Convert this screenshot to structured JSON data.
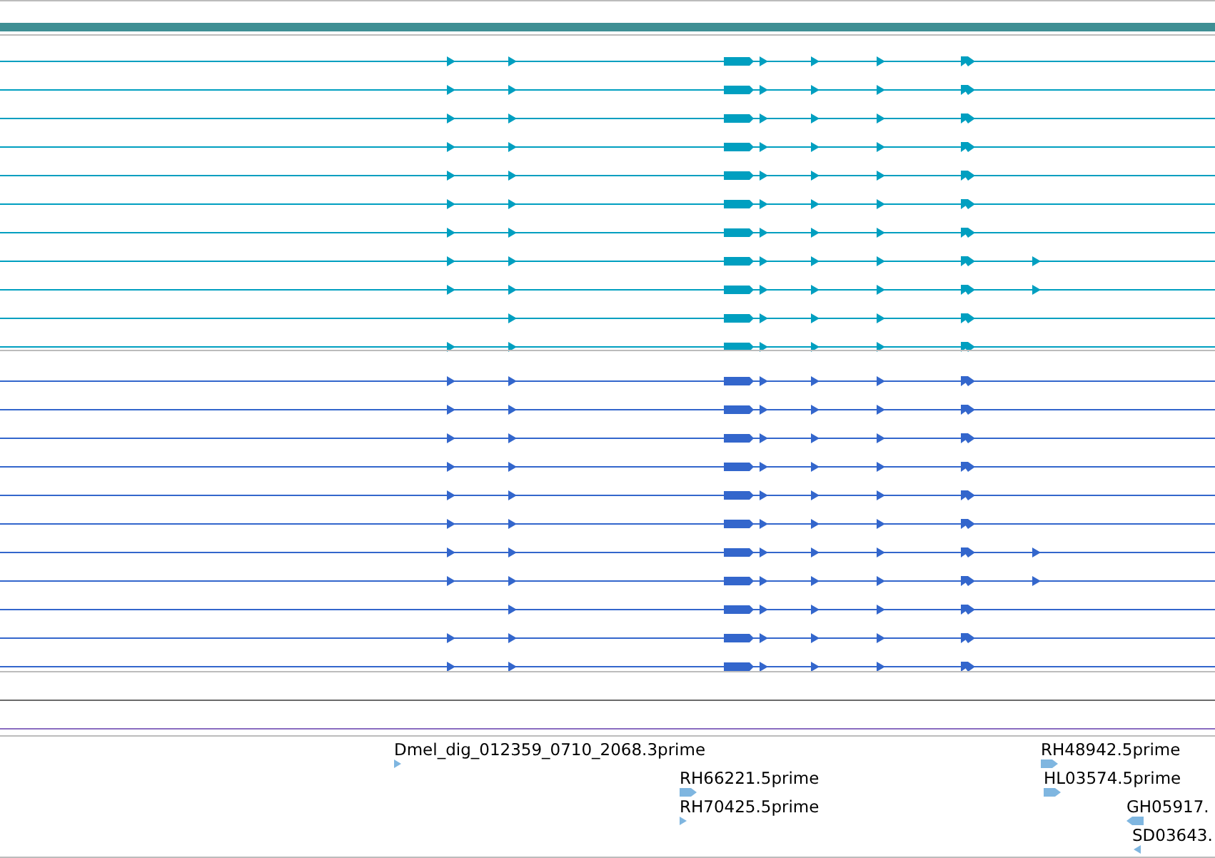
{
  "tracks": [
    {
      "color": "#009fc0",
      "transcripts": [
        {
          "exons": [
            true,
            true,
            true,
            true,
            true,
            true,
            true,
            false
          ]
        },
        {
          "exons": [
            true,
            true,
            true,
            true,
            true,
            true,
            true,
            false
          ]
        },
        {
          "exons": [
            true,
            true,
            true,
            true,
            true,
            true,
            true,
            false
          ]
        },
        {
          "exons": [
            true,
            true,
            true,
            true,
            true,
            true,
            true,
            false
          ]
        },
        {
          "exons": [
            true,
            true,
            true,
            true,
            true,
            true,
            true,
            false
          ]
        },
        {
          "exons": [
            true,
            true,
            true,
            true,
            true,
            true,
            true,
            false
          ]
        },
        {
          "exons": [
            true,
            true,
            true,
            true,
            true,
            true,
            true,
            false
          ]
        },
        {
          "exons": [
            true,
            true,
            true,
            true,
            true,
            true,
            true,
            true
          ]
        },
        {
          "exons": [
            true,
            true,
            true,
            true,
            true,
            true,
            true,
            true
          ]
        },
        {
          "exons": [
            false,
            true,
            true,
            true,
            true,
            true,
            true,
            false
          ]
        },
        {
          "exons": [
            true,
            true,
            true,
            true,
            true,
            true,
            true,
            false
          ]
        }
      ]
    },
    {
      "color": "#3366cc",
      "transcripts": [
        {
          "exons": [
            true,
            true,
            true,
            true,
            true,
            true,
            true,
            false
          ]
        },
        {
          "exons": [
            true,
            true,
            true,
            true,
            true,
            true,
            true,
            false
          ]
        },
        {
          "exons": [
            true,
            true,
            true,
            true,
            true,
            true,
            true,
            false
          ]
        },
        {
          "exons": [
            true,
            true,
            true,
            true,
            true,
            true,
            true,
            false
          ]
        },
        {
          "exons": [
            true,
            true,
            true,
            true,
            true,
            true,
            true,
            false
          ]
        },
        {
          "exons": [
            true,
            true,
            true,
            true,
            true,
            true,
            true,
            false
          ]
        },
        {
          "exons": [
            true,
            true,
            true,
            true,
            true,
            true,
            true,
            true
          ]
        },
        {
          "exons": [
            true,
            true,
            true,
            true,
            true,
            true,
            true,
            true
          ]
        },
        {
          "exons": [
            false,
            true,
            true,
            true,
            true,
            true,
            true,
            false
          ]
        },
        {
          "exons": [
            true,
            true,
            true,
            true,
            true,
            true,
            true,
            false
          ]
        },
        {
          "exons": [
            true,
            true,
            true,
            true,
            true,
            true,
            true,
            false
          ]
        }
      ]
    }
  ],
  "ests": [
    {
      "label": "Dmel_dig_012359_0710_2068.3prime",
      "reverse": false,
      "kind": "short"
    },
    {
      "label": "RH66221.5prime",
      "reverse": false,
      "kind": "long"
    },
    {
      "label": "RH70425.5prime",
      "reverse": false,
      "kind": "short"
    },
    {
      "label": "RH48942.5prime",
      "reverse": false,
      "kind": "long"
    },
    {
      "label": "HL03574.5prime",
      "reverse": false,
      "kind": "long"
    },
    {
      "label": "GH05917.",
      "reverse": true,
      "kind": "long"
    },
    {
      "label": "SD03643.",
      "reverse": true,
      "kind": "short"
    }
  ]
}
